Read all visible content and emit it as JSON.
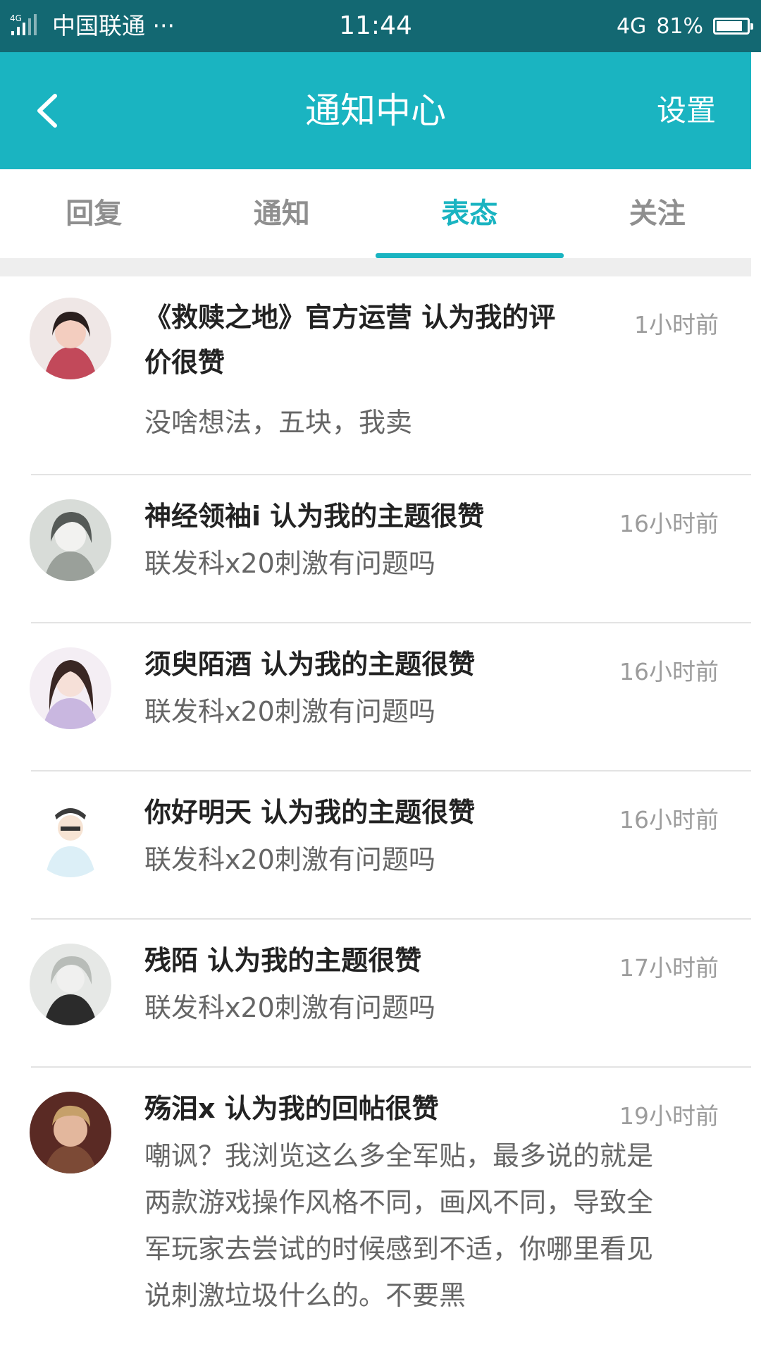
{
  "status_bar": {
    "network_small": "4G",
    "carrier": "中国联通 ···",
    "time": "11:44",
    "network": "4G",
    "battery": "81%",
    "battery_level": 0.81
  },
  "header": {
    "back_icon": "chevron-left-icon",
    "title": "通知中心",
    "settings_label": "设置"
  },
  "tabs": [
    {
      "label": "回复",
      "active": false
    },
    {
      "label": "通知",
      "active": false
    },
    {
      "label": "表态",
      "active": true
    },
    {
      "label": "关注",
      "active": false
    }
  ],
  "items": [
    {
      "title_line1": "《救赎之地》官方运营 认为我的评",
      "title_line2": "价很赞",
      "time": "1小时前",
      "body": [
        "没啥想法，五块，我卖"
      ]
    },
    {
      "title_line1": "神经领袖i 认为我的主题很赞",
      "time": "16小时前",
      "body": [
        "联发科x20刺激有问题吗"
      ]
    },
    {
      "title_line1": "须臾陌酒 认为我的主题很赞",
      "time": "16小时前",
      "body": [
        "联发科x20刺激有问题吗"
      ]
    },
    {
      "title_line1": "你好明天 认为我的主题很赞",
      "time": "16小时前",
      "body": [
        "联发科x20刺激有问题吗"
      ]
    },
    {
      "title_line1": "残陌 认为我的主题很赞",
      "time": "17小时前",
      "body": [
        "联发科x20刺激有问题吗"
      ]
    },
    {
      "title_line1": "殇泪x 认为我的回帖很赞",
      "time": "19小时前",
      "body": [
        "嘲讽？我浏览这么多全军贴，最多说的就是",
        "两款游戏操作风格不同，画风不同，导致全",
        "军玩家去尝试的时候感到不适，你哪里看见",
        "说刺激垃圾什么的。不要黑"
      ]
    }
  ],
  "colors": {
    "status_bar": "#136872",
    "accent": "#1ab4c1",
    "tab_inactive": "#8f8f8f",
    "time_text": "#9c9c9c"
  }
}
